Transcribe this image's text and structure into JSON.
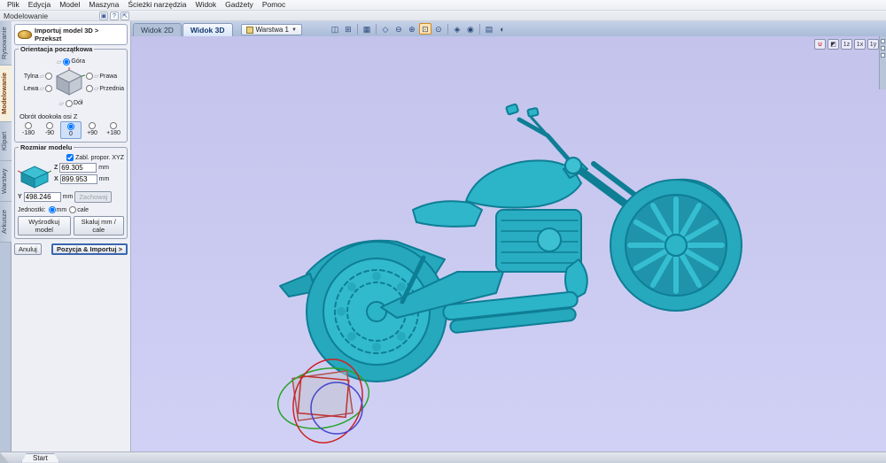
{
  "colors": {
    "viewport_bg_top": "#c3c3ec",
    "viewport_bg_bottom": "#d1d1f6",
    "model_fill": "#2cb4c8",
    "model_dark": "#26a8bd",
    "model_light": "#35bed2",
    "model_outline": "#0e7e95"
  },
  "menu": {
    "items": [
      "Plik",
      "Edycja",
      "Model",
      "Maszyna",
      "Ścieżki narzędzia",
      "Widok",
      "Gadżety",
      "Pomoc"
    ]
  },
  "row2": {
    "label": "Modelowanie",
    "icons": [
      {
        "name": "panel-toggle",
        "glyph": "▣"
      },
      {
        "name": "help",
        "glyph": "?"
      },
      {
        "name": "pin-panel",
        "glyph": "⇱"
      }
    ]
  },
  "tabbar": {
    "tab_2d": "Widok 2D",
    "tab_3d": "Widok 3D",
    "layer_label": "Warstwa 1",
    "caret": "▼",
    "icons": [
      {
        "name": "split-view",
        "glyph": "◫"
      },
      {
        "name": "multi-window",
        "glyph": "⊞"
      },
      {
        "name": "grid",
        "glyph": "▦"
      },
      {
        "name": "snap-diamond",
        "glyph": "◇"
      },
      {
        "name": "zoom-out",
        "glyph": "⊖"
      },
      {
        "name": "zoom-in",
        "glyph": "⊕"
      },
      {
        "name": "zoom-window",
        "glyph": "⊡"
      },
      {
        "name": "zoom-fit",
        "glyph": "⊙"
      },
      {
        "name": "zoom-object",
        "glyph": "◈"
      },
      {
        "name": "shade-view",
        "glyph": "◉"
      },
      {
        "name": "texture-view",
        "glyph": "▤"
      },
      {
        "name": "light-view",
        "glyph": "◐"
      }
    ]
  },
  "sidebar": {
    "tabs": [
      "Rysowanie",
      "Modelowanie",
      "Klipart",
      "Warstwy",
      "Arkusze"
    ],
    "active": "Modelowanie"
  },
  "panel": {
    "title": "Importuj model 3D > Przekszt",
    "orientation": {
      "title": "Orientacja początkowa",
      "options": [
        "Góra",
        "Tylna",
        "Prawa",
        "Lewa",
        "Przednia",
        "Dół"
      ],
      "selected": "Góra",
      "rotation_label": "Obrót dookoła osi Z",
      "rotation_options": [
        "-180",
        "-90",
        "0",
        "+90",
        "+180"
      ],
      "selected_rotation": "0"
    },
    "size": {
      "title": "Rozmiar modelu",
      "lock_label": "Zabl. propor. XYZ",
      "lock_checked": true,
      "axis_z": "Z",
      "axis_x": "X",
      "axis_y": "Y",
      "z_value": "69.305",
      "x_value": "899.953",
      "y_value": "498.246",
      "unit": "mm",
      "keep_button": "Zachowaj",
      "units_label": "Jednostki:",
      "unit_mm": "mm",
      "unit_cale": "cale",
      "selected_unit": "mm",
      "center_button": "Wyśrodkuj model",
      "scale_button": "Skaluj mm / cale"
    },
    "cancel_button": "Anuluj",
    "import_button": "Pozycja & Importuj >"
  },
  "viewport": {
    "corner_icons": [
      {
        "name": "magnet",
        "glyph": "∪"
      },
      {
        "name": "rotate-view",
        "glyph": "◩"
      },
      {
        "name": "iso-z",
        "glyph": "1z"
      },
      {
        "name": "iso-x",
        "glyph": "1x"
      },
      {
        "name": "iso-y",
        "glyph": "1y"
      }
    ]
  },
  "statusbar": {
    "start_label": "Start"
  }
}
